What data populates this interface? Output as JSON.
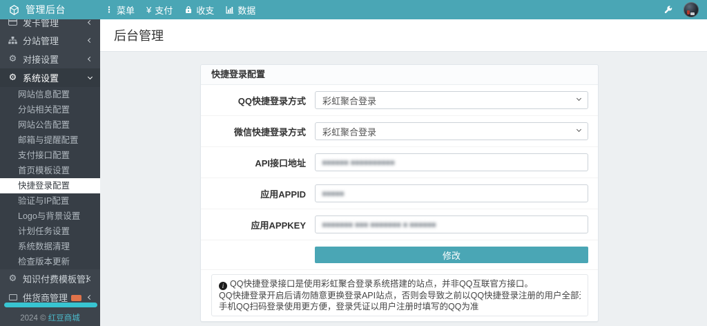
{
  "topbar": {
    "brand": "管理后台",
    "nav": [
      {
        "label": "菜单"
      },
      {
        "label": "支付"
      },
      {
        "label": "收支"
      },
      {
        "label": "数据"
      }
    ]
  },
  "sidebar": {
    "items": [
      {
        "label": "发卡管理"
      },
      {
        "label": "分站管理"
      },
      {
        "label": "对接设置"
      },
      {
        "label": "系统设置"
      },
      {
        "label": "知识付费模板管理"
      },
      {
        "label": "供货商管理"
      }
    ],
    "submenu": {
      "items": [
        {
          "label": "网站信息配置"
        },
        {
          "label": "分站相关配置"
        },
        {
          "label": "网站公告配置"
        },
        {
          "label": "邮箱与提醒配置"
        },
        {
          "label": "支付接口配置"
        },
        {
          "label": "首页模板设置"
        },
        {
          "label": "快捷登录配置"
        },
        {
          "label": "验证与IP配置"
        },
        {
          "label": "Logo与背景设置"
        },
        {
          "label": "计划任务设置"
        },
        {
          "label": "系统数据清理"
        },
        {
          "label": "检查版本更新"
        }
      ],
      "active": "快捷登录配置"
    },
    "footer": {
      "copyright": "2024 ©",
      "brand": "红豆商城"
    }
  },
  "page": {
    "title": "后台管理"
  },
  "panel": {
    "title": "快捷登录配置",
    "fields": [
      {
        "label": "QQ快捷登录方式",
        "type": "select",
        "value": "彩虹聚合登录"
      },
      {
        "label": "微信快捷登录方式",
        "type": "select",
        "value": "彩虹聚合登录"
      },
      {
        "label": "API接口地址",
        "type": "input",
        "value": "▆▆▆▆▆▆ ▆▆▆▆▆▆▆▆▆▆",
        "redacted": true
      },
      {
        "label": "应用APPID",
        "type": "input",
        "value": "▆▆▆▆▆",
        "redacted": true
      },
      {
        "label": "应用APPKEY",
        "type": "input",
        "value": "▆▆▆▆▆▆▆ ▆▆▆ ▆▆▆▆▆▆▆ ▆ ▆▆▆▆▆▆",
        "redacted": true
      }
    ],
    "submit": "修改",
    "notes": [
      "QQ快捷登录接口是使用彩虹聚合登录系统搭建的站点，并非QQ互联官方接口。",
      "QQ快捷登录开启后请勿随意更换登录API站点，否则会导致之前以QQ快捷登录注册的用户全部无法登录。",
      "手机QQ扫码登录使用更方便，登录凭证以用户注册时填写的QQ为准"
    ]
  },
  "colors": {
    "accent_teal": "#4aa6b5",
    "progress_cyan": "#38c4d1",
    "badge_orange": "#e0734a"
  }
}
